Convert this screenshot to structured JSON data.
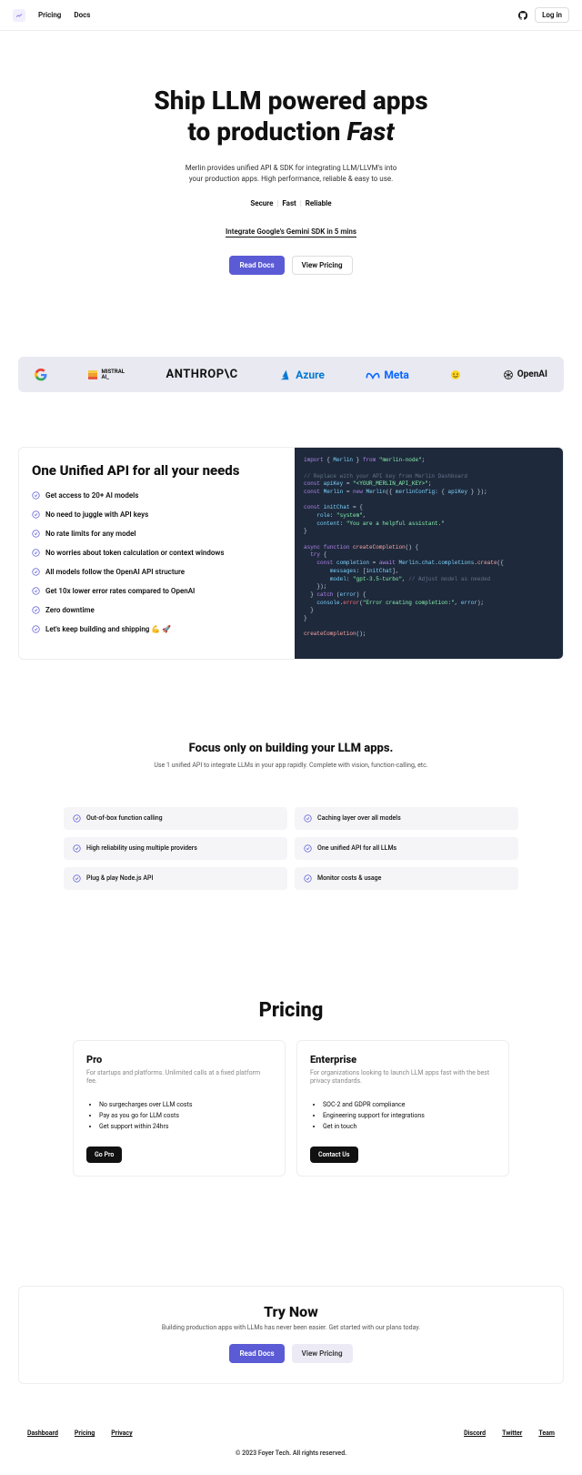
{
  "header": {
    "nav": [
      "Pricing",
      "Docs"
    ],
    "login": "Log in"
  },
  "hero": {
    "title_line1": "Ship LLM powered apps",
    "title_line2_prefix": "to production ",
    "title_line2_emph": "Fast",
    "sub1": "Merlin provides unified API & SDK for integrating LLM/LLVM's into",
    "sub2": "your production apps. High performance, reliable & easy to use.",
    "tags": [
      "Secure",
      "Fast",
      "Reliable"
    ],
    "integrate": "Integrate Google's Gemini SDK in 5 mins",
    "btn_primary": "Read Docs",
    "btn_secondary": "View Pricing"
  },
  "logos": [
    "G",
    "MISTRAL AI_",
    "ANTHROP\\C",
    "Azure",
    "Meta",
    "",
    "OpenAI"
  ],
  "unified": {
    "title": "One Unified API for all your needs",
    "features": [
      "Get access to 20+ AI models",
      "No need to juggle with API keys",
      "No rate limits for any model",
      "No worries about token calculation or context windows",
      "All models follow the OpenAI API structure",
      "Get 10x lower error rates compared to OpenAI",
      "Zero downtime",
      "Let's keep building and shipping 💪 🚀"
    ]
  },
  "focus": {
    "title": "Focus only on building your LLM apps.",
    "sub": "Use 1 unified API to integrate LLMs in your app rapidly. Complete with vision, function-calling, etc.",
    "cards": [
      "Out-of-box function calling",
      "Caching layer over all models",
      "High reliability using multiple providers",
      "One unified API for all LLMs",
      "Plug & play Node.js API",
      "Monitor costs & usage"
    ]
  },
  "pricing": {
    "title": "Pricing",
    "plans": [
      {
        "name": "Pro",
        "desc": "For startups and platforms. Unlimited calls at a fixed platform fee.",
        "items": [
          "No surgecharges over LLM costs",
          "Pay as you go for LLM costs",
          "Get support within 24hrs"
        ],
        "cta": "Go Pro"
      },
      {
        "name": "Enterprise",
        "desc": "For organizations looking to launch LLM apps fast with the best privacy standards.",
        "items": [
          "SOC-2 and GDPR compliance",
          "Engineering support for integrations",
          "Get in touch"
        ],
        "cta": "Contact Us"
      }
    ]
  },
  "trynow": {
    "title": "Try Now",
    "sub": "Building production apps with LLMs has never been easier. Get started with our plans today.",
    "btn_primary": "Read Docs",
    "btn_secondary": "View Pricing"
  },
  "footer": {
    "left": [
      "Dashboard",
      "Pricing",
      "Privacy"
    ],
    "right": [
      "Discord",
      "Twitter",
      "Team"
    ],
    "copyright": "© 2023 Foyer Tech. All rights reserved."
  },
  "colors": {
    "primary": "#5b5bd6",
    "codebg": "#1e293b"
  }
}
